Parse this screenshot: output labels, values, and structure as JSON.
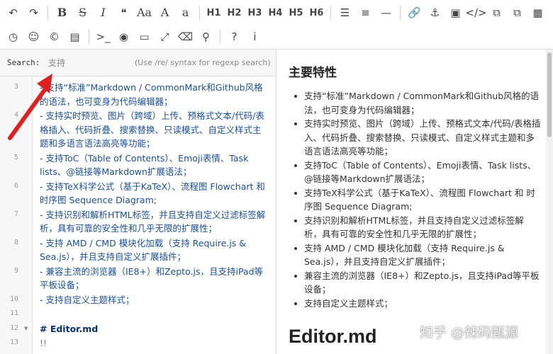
{
  "toolbar": {
    "row1": [
      {
        "name": "undo-icon",
        "glyph": "↶"
      },
      {
        "name": "redo-icon",
        "glyph": "↷"
      },
      {
        "name": "bold-icon",
        "glyph": "B"
      },
      {
        "name": "strikethrough-icon",
        "glyph": "S"
      },
      {
        "name": "italic-icon",
        "glyph": "I"
      },
      {
        "name": "quote-icon",
        "glyph": "❝"
      },
      {
        "name": "uppercase-icon",
        "glyph": "Aa"
      },
      {
        "name": "uppercase-a-icon",
        "glyph": "A"
      },
      {
        "name": "lowercase-a-icon",
        "glyph": "a"
      },
      {
        "name": "h1-button",
        "label": "H1"
      },
      {
        "name": "h2-button",
        "label": "H2"
      },
      {
        "name": "h3-button",
        "label": "H3"
      },
      {
        "name": "h4-button",
        "label": "H4"
      },
      {
        "name": "h5-button",
        "label": "H5"
      },
      {
        "name": "h6-button",
        "label": "H6"
      },
      {
        "name": "unordered-list-icon",
        "glyph": "☰"
      },
      {
        "name": "ordered-list-icon",
        "glyph": "≡"
      },
      {
        "name": "horizontal-rule-icon",
        "glyph": "—"
      },
      {
        "name": "link-icon",
        "glyph": "🔗"
      },
      {
        "name": "anchor-icon",
        "glyph": "⚓"
      },
      {
        "name": "image-icon",
        "glyph": "▣"
      },
      {
        "name": "code-icon",
        "glyph": "</>"
      },
      {
        "name": "code-block-icon",
        "glyph": "⧉"
      },
      {
        "name": "preformatted-icon",
        "glyph": "⧉"
      },
      {
        "name": "table-icon",
        "glyph": "▦"
      }
    ],
    "row2": [
      {
        "name": "datetime-icon",
        "glyph": "◷"
      },
      {
        "name": "emoji-icon",
        "glyph": "☺"
      },
      {
        "name": "html-entities-icon",
        "glyph": "©"
      },
      {
        "name": "pagebreak-icon",
        "glyph": "▤"
      },
      {
        "name": "terminal-icon",
        "glyph": ">_"
      },
      {
        "name": "watch-icon",
        "glyph": "◉"
      },
      {
        "name": "preview-icon",
        "glyph": "▭"
      },
      {
        "name": "fullscreen-icon",
        "glyph": "⤢"
      },
      {
        "name": "clear-icon",
        "glyph": "⌫"
      },
      {
        "name": "search-icon",
        "glyph": "⚲"
      },
      {
        "name": "help-icon",
        "glyph": "?"
      },
      {
        "name": "info-icon",
        "glyph": "i"
      }
    ]
  },
  "search": {
    "label": "Search:",
    "value": "支持",
    "hint": "(Use /re/ syntax for regexp search)"
  },
  "editor": {
    "lines": [
      {
        "num": "3",
        "text": "- 支持“标准”Markdown / CommonMark和Github风格的语法，也可变身为代码编辑器；",
        "rows": 2
      },
      {
        "num": "4",
        "text": "- 支持实时预览、图片（跨域）上传、预格式文本/代码/表格插入、代码折叠、搜索替换、只读模式、自定义样式主题和多语言语法高亮等功能；",
        "rows": 3
      },
      {
        "num": "5",
        "text": "- 支持ToC（Table of Contents）、Emoji表情、Task lists、@链接等Markdown扩展语法；",
        "rows": 2
      },
      {
        "num": "6",
        "text": "- 支持TeX科学公式（基于KaTeX）、流程图 Flowchart 和 时序图 Sequence Diagram;",
        "rows": 2
      },
      {
        "num": "7",
        "text": "- 支持识别和解析HTML标签，并且支持自定义过滤标签解析，具有可靠的安全性和几乎无限的扩展性；",
        "rows": 2
      },
      {
        "num": "8",
        "text": "- 支持 AMD / CMD 模块化加载（支持 Require.js & Sea.js），并且支持自定义扩展插件；",
        "rows": 2
      },
      {
        "num": "9",
        "text": "- 兼容主流的浏览器（IE8+）和Zepto.js，且支持iPad等平板设备；",
        "rows": 2
      },
      {
        "num": "10",
        "text": "- 支持自定义主题样式；",
        "rows": 1
      },
      {
        "num": "11",
        "text": "",
        "rows": 1
      },
      {
        "num": "12",
        "text": "# Editor.md",
        "rows": 1,
        "heading": true,
        "fold": true
      },
      {
        "num": "13",
        "text": "!!",
        "rows": 1,
        "dim": true
      }
    ]
  },
  "preview": {
    "h2": "主要特性",
    "items": [
      "支持“标准”Markdown / CommonMark和Github风格的语法，也可变身为代码编辑器；",
      "支持实时预览、图片（跨域）上传、预格式文本/代码/表格插入、代码折叠、搜索替换、只读模式、自定义样式主题和多语言语法高亮等功能；",
      "支持ToC（Table of Contents）、Emoji表情、Task lists、@链接等Markdown扩展语法；",
      "支持TeX科学公式（基于KaTeX）、流程图 Flowchart 和 时序图 Sequence Diagram;",
      "支持识别和解析HTML标签，并且支持自定义过滤标签解析，具有可靠的安全性和几乎无限的扩展性；",
      "支持 AMD / CMD 模块化加载（支持 Require.js & Sea.js），并且支持自定义扩展插件；",
      "兼容主流的浏览器（IE8+）和Zepto.js，且支持iPad等平板设备；",
      "支持自定义主题样式；"
    ],
    "h1": "Editor.md"
  },
  "watermark": "知乎 @辣码甄源",
  "colors": {
    "arrow": "#e02020",
    "code_text": "#1a4f9a",
    "heading_text": "#0a2f7a"
  }
}
